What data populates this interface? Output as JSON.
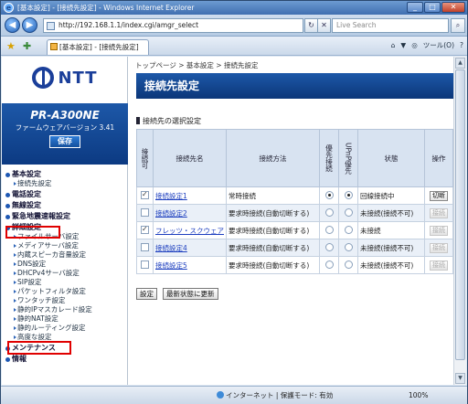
{
  "window": {
    "title": "[基本設定] - [接続先設定] - Windows Internet Explorer"
  },
  "addressbar": {
    "url": "http://192.168.1.1/index.cgi/amgr_select",
    "search_placeholder": "Live Search"
  },
  "tab": {
    "title": "[基本設定] - [接続先設定]"
  },
  "toolbar": {
    "home": "⌂",
    "feeds": "▼",
    "print": "◎",
    "tools": "ツール(O)",
    "help": "?"
  },
  "sidebar": {
    "logo_text": "NTT",
    "model": "PR-A300NE",
    "firmware": "ファームウェアバージョン 3.41",
    "save_label": "保存",
    "menu": [
      {
        "type": "main",
        "label": "基本設定"
      },
      {
        "type": "sub",
        "label": "接続先設定"
      },
      {
        "type": "main",
        "label": "電話設定"
      },
      {
        "type": "main",
        "label": "無線設定"
      },
      {
        "type": "main",
        "label": "緊急地震速報設定"
      },
      {
        "type": "main",
        "label": "詳細設定"
      },
      {
        "type": "sub",
        "label": "ファイルサーバ設定"
      },
      {
        "type": "sub",
        "label": "メディアサーバ設定"
      },
      {
        "type": "sub",
        "label": "内蔵スピーカ音量設定"
      },
      {
        "type": "sub",
        "label": "DNS設定"
      },
      {
        "type": "sub",
        "label": "DHCPv4サーバ設定"
      },
      {
        "type": "sub",
        "label": "SIP設定"
      },
      {
        "type": "sub",
        "label": "パケットフィルタ設定"
      },
      {
        "type": "sub",
        "label": "ワンタッチ設定"
      },
      {
        "type": "sub",
        "label": "静的IPマスカレード設定"
      },
      {
        "type": "sub",
        "label": "静的NAT設定"
      },
      {
        "type": "sub",
        "label": "静的ルーティング設定"
      },
      {
        "type": "sub",
        "label": "高度な設定"
      },
      {
        "type": "main",
        "label": "メンテナンス"
      },
      {
        "type": "main",
        "label": "情報"
      }
    ]
  },
  "main": {
    "breadcrumb": "トップページ > 基本設定 > 接続先設定",
    "title": "接続先設定",
    "section": "接続先の選択設定",
    "headers": [
      "接続可",
      "接続先名",
      "接続方法",
      "優先接続",
      "UPnP優先",
      "状態",
      "操作"
    ],
    "rows": [
      {
        "enabled": true,
        "name": "接続設定1",
        "method": "常時接続",
        "priority": true,
        "upnp": true,
        "status": "回線接続中",
        "op": "切断",
        "op_enabled": true
      },
      {
        "enabled": false,
        "name": "接続設定2",
        "method": "要求時接続(自動切断する)",
        "priority": false,
        "upnp": false,
        "status": "未接続(接続不可)",
        "op": "接続",
        "op_enabled": false
      },
      {
        "enabled": true,
        "name": "フレッツ・スクウェア",
        "method": "要求時接続(自動切断する)",
        "priority": false,
        "upnp": false,
        "status": "未接続",
        "op": "接続",
        "op_enabled": false
      },
      {
        "enabled": false,
        "name": "接続設定4",
        "method": "要求時接続(自動切断する)",
        "priority": false,
        "upnp": false,
        "status": "未接続(接続不可)",
        "op": "接続",
        "op_enabled": false
      },
      {
        "enabled": false,
        "name": "接続設定5",
        "method": "要求時接続(自動切断する)",
        "priority": false,
        "upnp": false,
        "status": "未接続(接続不可)",
        "op": "接続",
        "op_enabled": false
      }
    ],
    "set_label": "設定",
    "refresh_label": "最新状態に更新"
  },
  "statusbar": {
    "zone": "インターネット | 保護モード: 有効",
    "zoom": "100%"
  }
}
